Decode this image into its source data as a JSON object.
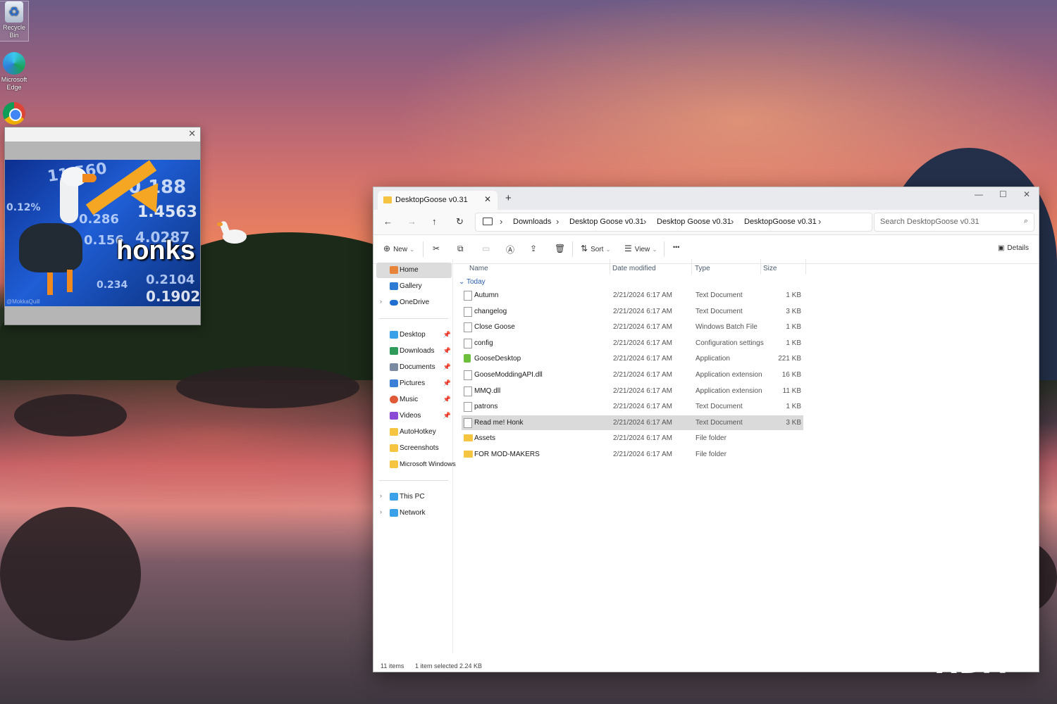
{
  "desktop": {
    "icons": [
      {
        "label": "Recycle Bin"
      },
      {
        "label": "Microsoft Edge"
      },
      {
        "label": ""
      }
    ]
  },
  "meme": {
    "caption": "honks",
    "numbers": [
      "11.560",
      "0.188",
      "1.4563",
      "0.286",
      "0.156",
      "0.234",
      "0.1902",
      "0.2104",
      "4.0287",
      "0.12%"
    ],
    "credit": "@MokkaQuill",
    "close_glyph": "✕"
  },
  "explorer": {
    "tab_title": "DesktopGoose v0.31",
    "tab_close": "✕",
    "new_tab": "+",
    "window_controls": {
      "minimize": "—",
      "maximize": "☐",
      "close": "✕"
    },
    "nav": {
      "back": "←",
      "forward": "→",
      "up": "↑",
      "refresh": "↻"
    },
    "breadcrumbs": [
      "Downloads",
      "Desktop Goose v0.31",
      "Desktop Goose v0.31",
      "DesktopGoose v0.31"
    ],
    "search_placeholder": "Search DesktopGoose v0.31",
    "toolbar": {
      "new_label": "New",
      "sort_label": "Sort",
      "view_label": "View",
      "more_label": "•••",
      "details_label": "Details"
    },
    "sidebar": {
      "top": [
        {
          "label": "Home",
          "active": true,
          "color": "#e8833a"
        },
        {
          "label": "Gallery",
          "color": "#2e7bd6"
        },
        {
          "label": "OneDrive",
          "color": "#1f6fd1",
          "expandable": true
        }
      ],
      "quick": [
        {
          "label": "Desktop",
          "color": "#3aa0e8",
          "pinned": true
        },
        {
          "label": "Downloads",
          "color": "#2e9b5a",
          "pinned": true
        },
        {
          "label": "Documents",
          "color": "#7a8aa0",
          "pinned": true
        },
        {
          "label": "Pictures",
          "color": "#3b7fd6",
          "pinned": true
        },
        {
          "label": "Music",
          "color": "#e05a3a",
          "pinned": true
        },
        {
          "label": "Videos",
          "color": "#8a4ad6",
          "pinned": true
        },
        {
          "label": "AutoHotkey",
          "color": "#f5c542"
        },
        {
          "label": "Screenshots",
          "color": "#f5c542"
        },
        {
          "label": "Microsoft Windows",
          "color": "#f5c542"
        }
      ],
      "bottom": [
        {
          "label": "This PC",
          "color": "#3aa0e8",
          "expandable": true
        },
        {
          "label": "Network",
          "color": "#3aa0e8",
          "expandable": true
        }
      ]
    },
    "columns": {
      "name": "Name",
      "date": "Date modified",
      "type": "Type",
      "size": "Size"
    },
    "group_label": "Today",
    "files": [
      {
        "name": "Autumn",
        "date": "2/21/2024 6:17 AM",
        "type": "Text Document",
        "size": "1 KB",
        "kind": "doc"
      },
      {
        "name": "changelog",
        "date": "2/21/2024 6:17 AM",
        "type": "Text Document",
        "size": "3 KB",
        "kind": "doc"
      },
      {
        "name": "Close Goose",
        "date": "2/21/2024 6:17 AM",
        "type": "Windows Batch File",
        "size": "1 KB",
        "kind": "doc"
      },
      {
        "name": "config",
        "date": "2/21/2024 6:17 AM",
        "type": "Configuration settings",
        "size": "1 KB",
        "kind": "doc"
      },
      {
        "name": "GooseDesktop",
        "date": "2/21/2024 6:17 AM",
        "type": "Application",
        "size": "221 KB",
        "kind": "app"
      },
      {
        "name": "GooseModdingAPI.dll",
        "date": "2/21/2024 6:17 AM",
        "type": "Application extension",
        "size": "16 KB",
        "kind": "doc"
      },
      {
        "name": "MMQ.dll",
        "date": "2/21/2024 6:17 AM",
        "type": "Application extension",
        "size": "11 KB",
        "kind": "doc"
      },
      {
        "name": "patrons",
        "date": "2/21/2024 6:17 AM",
        "type": "Text Document",
        "size": "1 KB",
        "kind": "doc"
      },
      {
        "name": "Read me! Honk",
        "date": "2/21/2024 6:17 AM",
        "type": "Text Document",
        "size": "3 KB",
        "kind": "doc",
        "selected": true
      },
      {
        "name": "Assets",
        "date": "2/21/2024 6:17 AM",
        "type": "File folder",
        "size": "",
        "kind": "folder"
      },
      {
        "name": "FOR MOD-MAKERS",
        "date": "2/21/2024 6:17 AM",
        "type": "File folder",
        "size": "",
        "kind": "folder"
      }
    ],
    "status": {
      "count": "11 items",
      "selection": "1 item selected  2.24 KB"
    }
  },
  "watermark": "XDA"
}
